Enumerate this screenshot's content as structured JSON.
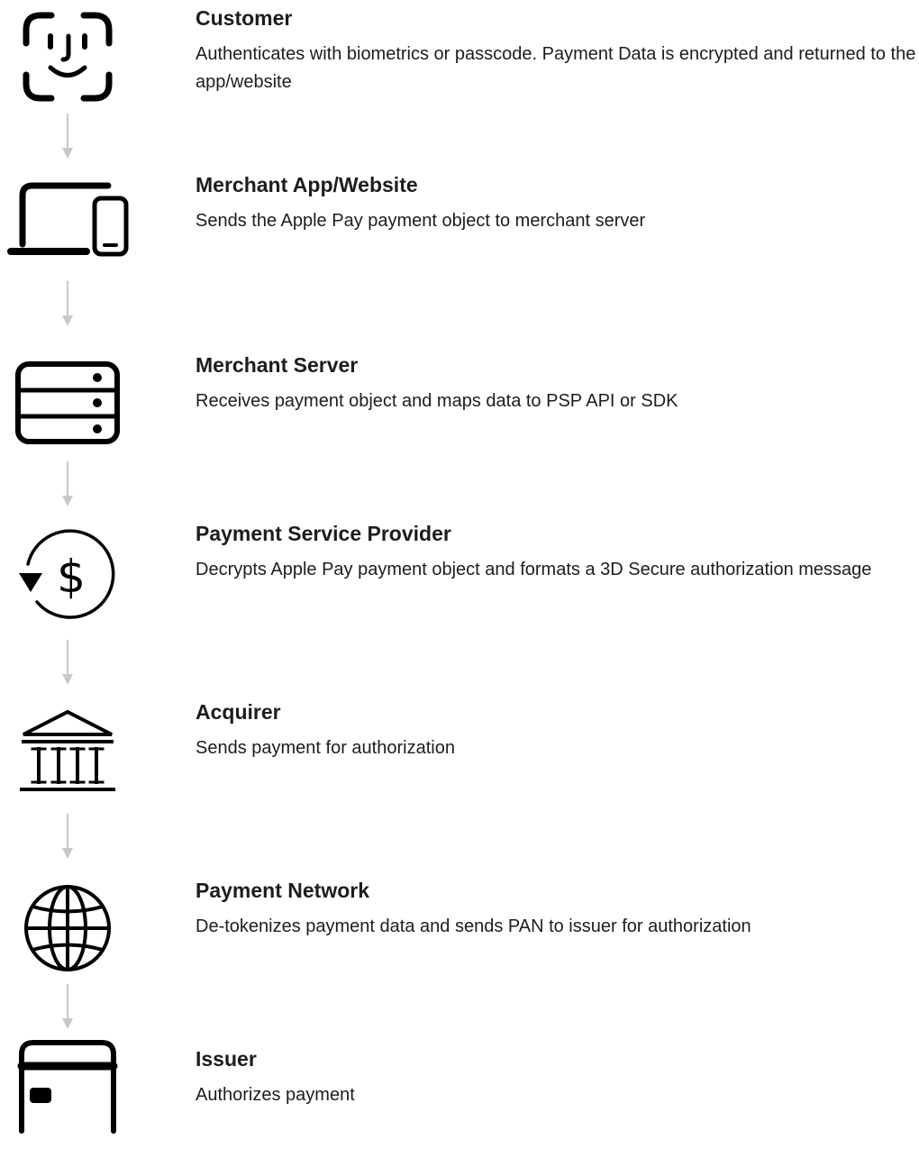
{
  "steps": [
    {
      "icon": "face-id-icon",
      "title": "Customer",
      "description": "Authenticates with biometrics or passcode. Payment Data is encrypted and returned to the app/website"
    },
    {
      "icon": "laptop-phone-icon",
      "title": "Merchant App/Website",
      "description": "Sends the Apple Pay payment object to merchant server"
    },
    {
      "icon": "server-icon",
      "title": "Merchant Server",
      "description": "Receives payment object and maps data to PSP API or SDK"
    },
    {
      "icon": "dollar-cycle-icon",
      "title": "Payment Service Provider",
      "description": "Decrypts Apple Pay payment object and formats a 3D Secure authorization message"
    },
    {
      "icon": "bank-icon",
      "title": "Acquirer",
      "description": "Sends payment for authorization"
    },
    {
      "icon": "globe-icon",
      "title": "Payment Network",
      "description": "De-tokenizes payment data and sends PAN to issuer for authorization"
    },
    {
      "icon": "credit-card-icon",
      "title": "Issuer",
      "description": "Authorizes payment"
    }
  ],
  "colors": {
    "icon": "#000000",
    "text": "#1d1d1f",
    "arrow": "#c8c8c8"
  }
}
